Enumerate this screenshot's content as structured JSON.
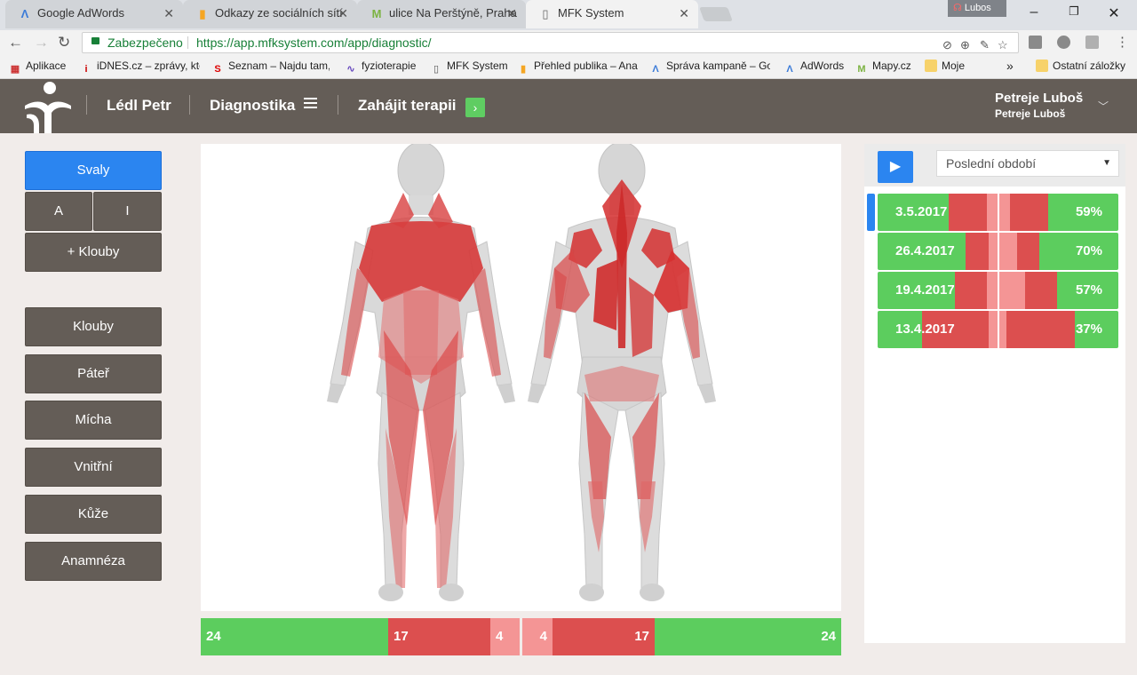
{
  "browser": {
    "tabs": [
      {
        "label": "Google AdWords",
        "icon": "adwords-icon",
        "active": false
      },
      {
        "label": "Odkazy ze sociálních sítí",
        "icon": "analytics-icon",
        "active": false
      },
      {
        "label": "ulice Na Perštýně, Praha",
        "icon": "mapy-icon",
        "active": false
      },
      {
        "label": "MFK System",
        "icon": "page-icon",
        "active": true
      }
    ],
    "profile": "Lubos",
    "secure_label": "Zabezpečeno",
    "url": "https://app.mfksystem.com/app/diagnostic/",
    "bookmarks": [
      {
        "label": "Aplikace",
        "icon": "apps-icon"
      },
      {
        "label": "iDNES.cz – zprávy, kte",
        "icon": "idnes-icon"
      },
      {
        "label": "Seznam – Najdu tam,",
        "icon": "seznam-icon"
      },
      {
        "label": "fyzioterapie",
        "icon": "pulse-icon"
      },
      {
        "label": "MFK System",
        "icon": "page-icon"
      },
      {
        "label": "Přehled publika – Ana",
        "icon": "analytics-icon"
      },
      {
        "label": "Správa kampaně – Go",
        "icon": "adwords-icon"
      },
      {
        "label": "AdWords",
        "icon": "adwords-icon"
      },
      {
        "label": "Mapy.cz",
        "icon": "mapy-icon"
      },
      {
        "label": "Moje",
        "icon": "folder-icon"
      }
    ],
    "more_bookmarks": "»",
    "other_bookmarks": "Ostatní záložky"
  },
  "header": {
    "patient": "Lédl Petr",
    "section": "Diagnostika",
    "start_therapy": "Zahájit terapii",
    "user_name": "Petreje Luboš",
    "user_sub": "Petreje Luboš"
  },
  "sidebar": {
    "active": "Svaly",
    "toggle_a": "A",
    "toggle_i": "I",
    "add_joints": "+ Klouby",
    "items": [
      "Klouby",
      "Páteř",
      "Mícha",
      "Vnitřní",
      "Kůže",
      "Anamnéza"
    ]
  },
  "bottom_bar": {
    "segments": [
      {
        "value": "24",
        "color": "#5ccd5e"
      },
      {
        "value": "17",
        "color": "#dc4f4f"
      },
      {
        "value": "4",
        "color": "#f49595"
      },
      {
        "value": "4",
        "color": "#f49595"
      },
      {
        "value": "17",
        "color": "#dc4f4f"
      },
      {
        "value": "24",
        "color": "#5ccd5e"
      }
    ]
  },
  "history": {
    "period": "Poslední období",
    "rows": [
      {
        "date": "3.5.2017",
        "percent": "59%"
      },
      {
        "date": "26.4.2017",
        "percent": "70%"
      },
      {
        "date": "19.4.2017",
        "percent": "57%"
      },
      {
        "date": "13.4.2017",
        "percent": "37%"
      }
    ]
  },
  "colors": {
    "green": "#5ccd5e",
    "red": "#dc4f4f",
    "pink": "#f49595",
    "accent": "#2b85f0",
    "header": "#645d57"
  }
}
